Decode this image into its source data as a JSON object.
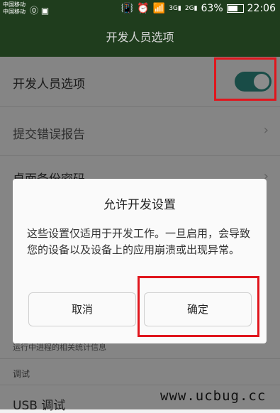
{
  "status_bar": {
    "carrier_1": "中国移动",
    "carrier_2": "中国移动",
    "icons": [
      "sim-icon",
      "image-icon",
      "vibrate-icon",
      "alarm-icon",
      "wifi-icon",
      "signal-3g-icon",
      "signal-2g-icon"
    ],
    "net_1": "3G",
    "net_2": "2G",
    "battery_percent_text": "63%",
    "battery_level": 0.63,
    "time": "22:06"
  },
  "header": {
    "title": "开发人员选项"
  },
  "settings": {
    "developer_options_label": "开发人员选项",
    "developer_options_enabled": true,
    "submit_bug_report": "提交错误报告",
    "desktop_backup_password": "桌面备份密码",
    "process_stats_desc": "运行中进程的相关统计信息",
    "debug_section": "调试",
    "usb_debug": "USB 调试"
  },
  "dialog": {
    "title": "允许开发设置",
    "message": "这些设置仅适用于开发工作。一旦启用，会导致您的设备以及设备上的应用崩溃或出现异常。",
    "cancel_label": "取消",
    "confirm_label": "确定"
  },
  "highlight_color": "#e0161d",
  "accent_color": "#2e8b82",
  "watermark": "www.ucbug.cc"
}
